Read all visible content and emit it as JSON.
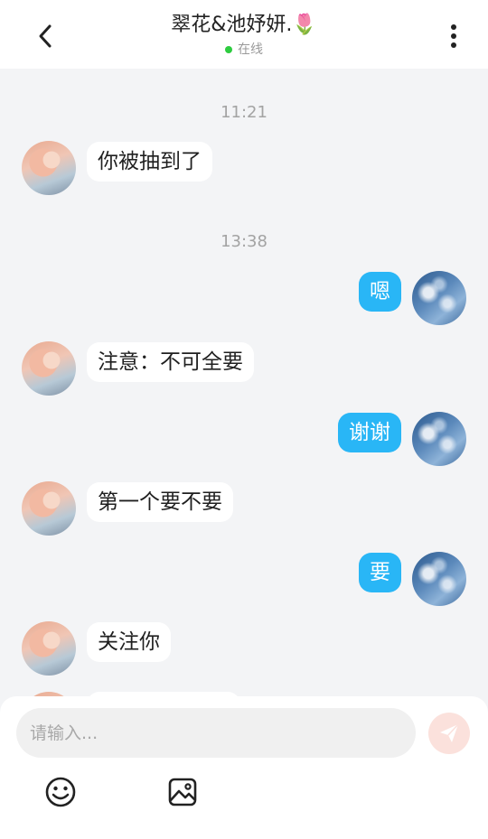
{
  "header": {
    "title": "翠花&池妤妍.🌷",
    "status": "在线"
  },
  "messages": [
    {
      "time": "11:21"
    },
    {
      "from": "them",
      "text": "你被抽到了"
    },
    {
      "time": "13:38"
    },
    {
      "from": "me",
      "text": "嗯"
    },
    {
      "from": "them",
      "text": "注意：不可全要"
    },
    {
      "from": "me",
      "text": "谢谢"
    },
    {
      "from": "them",
      "text": "第一个要不要"
    },
    {
      "from": "me",
      "text": "要"
    },
    {
      "from": "them",
      "text": "关注你"
    }
  ],
  "composer": {
    "placeholder": "请输入..."
  },
  "icons": {
    "back": "back-arrow-icon",
    "more": "more-vertical-icon",
    "send": "send-icon",
    "emoji": "emoji-icon",
    "image": "image-icon"
  },
  "colors": {
    "my_bubble": "#29b6f6",
    "their_bubble": "#ffffff",
    "online_dot": "#2ecc40",
    "send_button": "#fbe1dc"
  }
}
